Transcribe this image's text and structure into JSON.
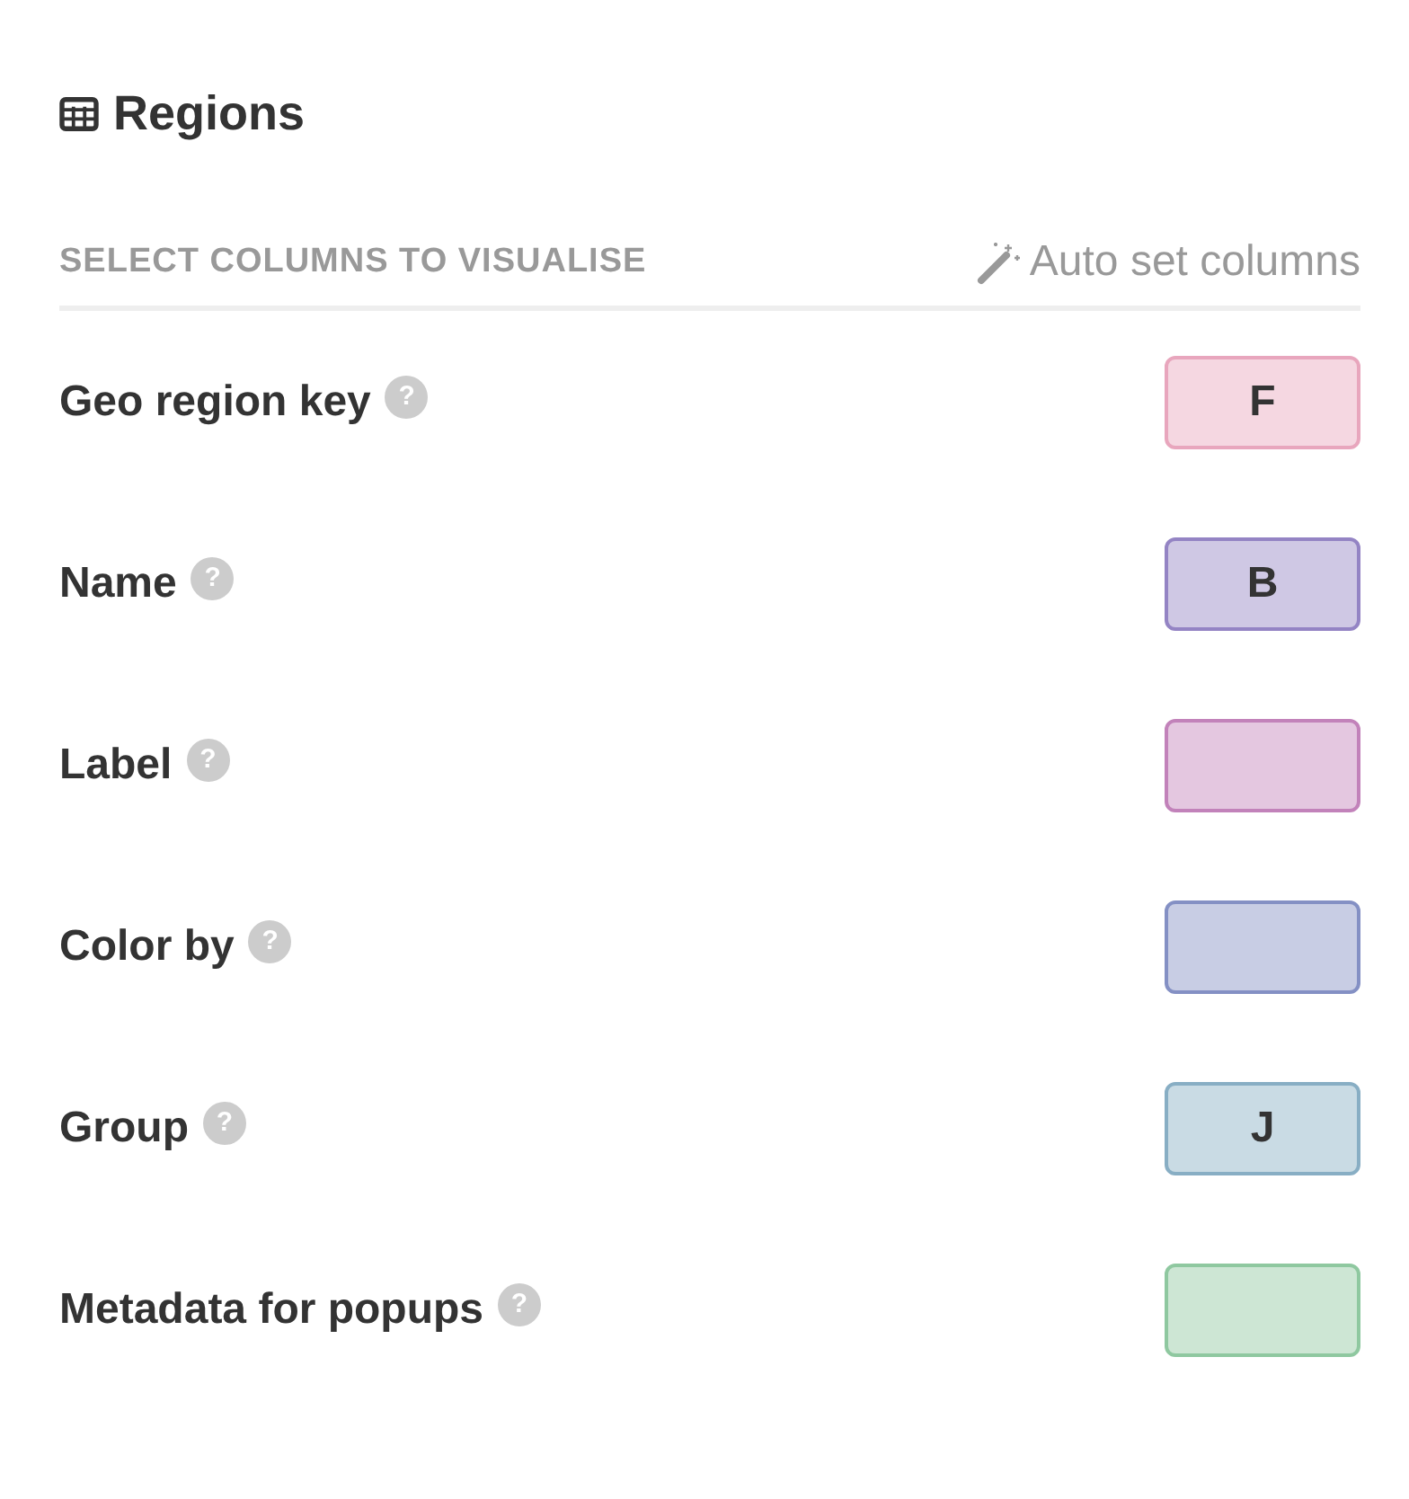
{
  "panel": {
    "title": "Regions"
  },
  "section": {
    "heading": "SELECT COLUMNS TO VISUALISE",
    "action": "Auto set columns"
  },
  "fields": [
    {
      "label": "Geo region key",
      "help": "?",
      "column": "F",
      "color": "#e8a6bd"
    },
    {
      "label": "Name",
      "help": "?",
      "column": "B",
      "color": "#9484c4"
    },
    {
      "label": "Label",
      "help": "?",
      "color": "#c282ba"
    },
    {
      "label": "Color by",
      "help": "?",
      "color": "#8490c4"
    },
    {
      "label": "Group",
      "help": "?",
      "column": "J",
      "color": "#88aec4"
    },
    {
      "label": "Metadata for popups",
      "help": "?",
      "color": "#8fc8a0"
    }
  ]
}
